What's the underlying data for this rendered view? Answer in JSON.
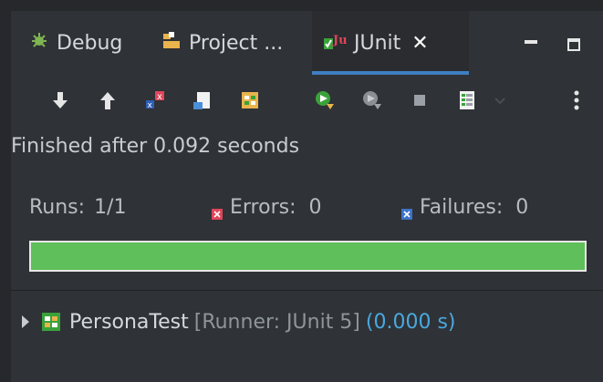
{
  "tabs": [
    {
      "label": "Debug",
      "icon": "debug-bug-icon"
    },
    {
      "label": "Project ...",
      "icon": "project-explorer-icon"
    },
    {
      "label": "JUnit",
      "icon": "junit-icon",
      "active": true
    }
  ],
  "toolbar": {
    "icons": [
      "next-failure-icon",
      "previous-failure-icon",
      "show-failures-only-icon",
      "scroll-lock-icon",
      "show-skipped-icon",
      "rerun-test-icon",
      "rerun-failed-first-icon",
      "stop-icon",
      "test-run-history-icon",
      "history-dropdown-icon",
      "view-menu-icon"
    ]
  },
  "status": "Finished after 0.092 seconds",
  "counters": {
    "runs_label": "Runs:",
    "runs_value": "1/1",
    "errors_label": "Errors:",
    "errors_value": "0",
    "failures_label": "Failures:",
    "failures_value": "0"
  },
  "progress": {
    "fraction": 1.0,
    "color": "#5fbf5a"
  },
  "tree": {
    "name": "PersonaTest",
    "runner": "[Runner: JUnit 5]",
    "time": "(0.000 s)"
  },
  "colors": {
    "accent": "#3f7dc2",
    "error": "#e0455a",
    "failure": "#3d73c9",
    "time": "#4aa8e0"
  }
}
